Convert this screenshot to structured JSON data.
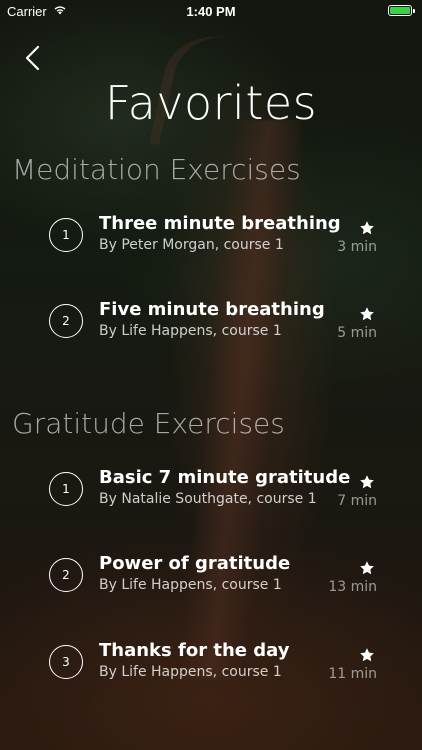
{
  "status_bar": {
    "carrier": "Carrier",
    "time": "1:40 PM",
    "battery_level": 1.0
  },
  "header": {
    "title": "Favorites"
  },
  "sections": [
    {
      "title": "Meditation Exercises",
      "items": [
        {
          "number": "1",
          "name": "Three minute breathing",
          "subtitle": "By Peter Morgan, course 1",
          "duration": "3 min"
        },
        {
          "number": "2",
          "name": "Five minute breathing",
          "subtitle": "By Life Happens, course 1",
          "duration": "5 min"
        }
      ]
    },
    {
      "title": "Gratitude Exercises",
      "items": [
        {
          "number": "1",
          "name": "Basic 7 minute gratitude",
          "subtitle": "By Natalie Southgate, course 1",
          "duration": "7 min"
        },
        {
          "number": "2",
          "name": "Power of gratitude",
          "subtitle": "By Life Happens, course 1",
          "duration": "13 min"
        },
        {
          "number": "3",
          "name": "Thanks for the day",
          "subtitle": "By Life Happens, course 1",
          "duration": "11 min"
        }
      ]
    }
  ],
  "icons": {
    "back": "chevron-left-icon",
    "favorite": "star-icon",
    "wifi": "wifi-icon",
    "battery": "battery-icon"
  },
  "colors": {
    "battery": "#3ad24a",
    "text": "#ffffff"
  }
}
